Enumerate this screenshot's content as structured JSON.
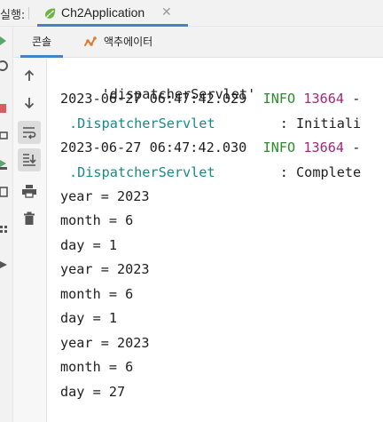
{
  "titlebar": {
    "prefix": "실행:",
    "tab_label": "Ch2Application",
    "close_glyph": "✕"
  },
  "console_tabs": [
    {
      "label": "콘솔",
      "active": true
    },
    {
      "label": "액추에이터",
      "active": false
    }
  ],
  "console": {
    "lines": {
      "l0": "'dispatcherServlet'",
      "l1_time": "2023-06-27 06:47:42.029",
      "l1_level": "INFO",
      "l1_pid": "13664",
      "l1_tail": " -",
      "l2_class": ".DispatcherServlet",
      "l2_msg": ": Initiali",
      "l3_time": "2023-06-27 06:47:42.030",
      "l3_level": "INFO",
      "l3_pid": "13664",
      "l3_tail": " -",
      "l4_class": ".DispatcherServlet",
      "l4_msg": ": Complete",
      "l5": "year = 2023",
      "l6": "month = 6",
      "l7": "day = 1",
      "l8": "year = 2023",
      "l9": "month = 6",
      "l10": "day = 1",
      "l11": "year = 2023",
      "l12": "month = 6",
      "l13": "day = 27"
    }
  },
  "colors": {
    "accent": "#4083c9",
    "log_level_info": "#2e8b2e",
    "log_pid": "#a4277a",
    "log_class": "#198a8a"
  }
}
